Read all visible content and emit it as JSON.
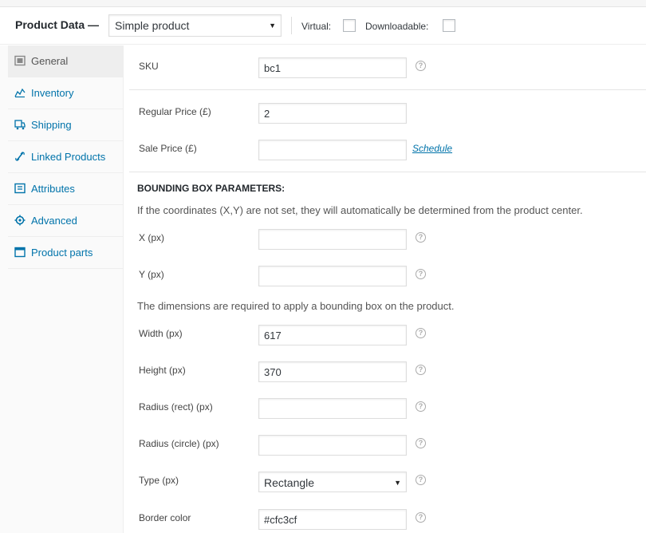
{
  "header": {
    "title": "Product Data —",
    "product_type": "Simple product",
    "virtual_label": "Virtual:",
    "downloadable_label": "Downloadable:"
  },
  "sidebar": {
    "items": [
      {
        "label": "General",
        "icon": "general-icon"
      },
      {
        "label": "Inventory",
        "icon": "inventory-icon"
      },
      {
        "label": "Shipping",
        "icon": "shipping-icon"
      },
      {
        "label": "Linked Products",
        "icon": "link-icon"
      },
      {
        "label": "Attributes",
        "icon": "attributes-icon"
      },
      {
        "label": "Advanced",
        "icon": "gear-icon"
      },
      {
        "label": "Product parts",
        "icon": "window-icon"
      }
    ]
  },
  "fields": {
    "sku": {
      "label": "SKU",
      "value": "bc1"
    },
    "regular_price": {
      "label": "Regular Price (£)",
      "value": "2"
    },
    "sale_price": {
      "label": "Sale Price (£)",
      "value": ""
    },
    "schedule_link": "Schedule",
    "section_title": "BOUNDING BOX PARAMETERS:",
    "coords_note": "If the coordinates (X,Y) are not set, they will automatically be determined from the product center.",
    "x": {
      "label": "X (px)",
      "value": ""
    },
    "y": {
      "label": "Y (px)",
      "value": ""
    },
    "dims_note": "The dimensions are required to apply a bounding box on the product.",
    "width": {
      "label": "Width (px)",
      "value": "617"
    },
    "height": {
      "label": "Height (px)",
      "value": "370"
    },
    "radius_rect": {
      "label": "Radius (rect) (px)",
      "value": ""
    },
    "radius_circle": {
      "label": "Radius (circle) (px)",
      "value": ""
    },
    "type": {
      "label": "Type (px)",
      "value": "Rectangle"
    },
    "border_color": {
      "label": "Border color",
      "value": "#cfc3cf"
    }
  },
  "colors": {
    "link": "#0073aa",
    "active_tab_bg": "#eeeeee",
    "sidebar_bg": "#fafafa"
  }
}
